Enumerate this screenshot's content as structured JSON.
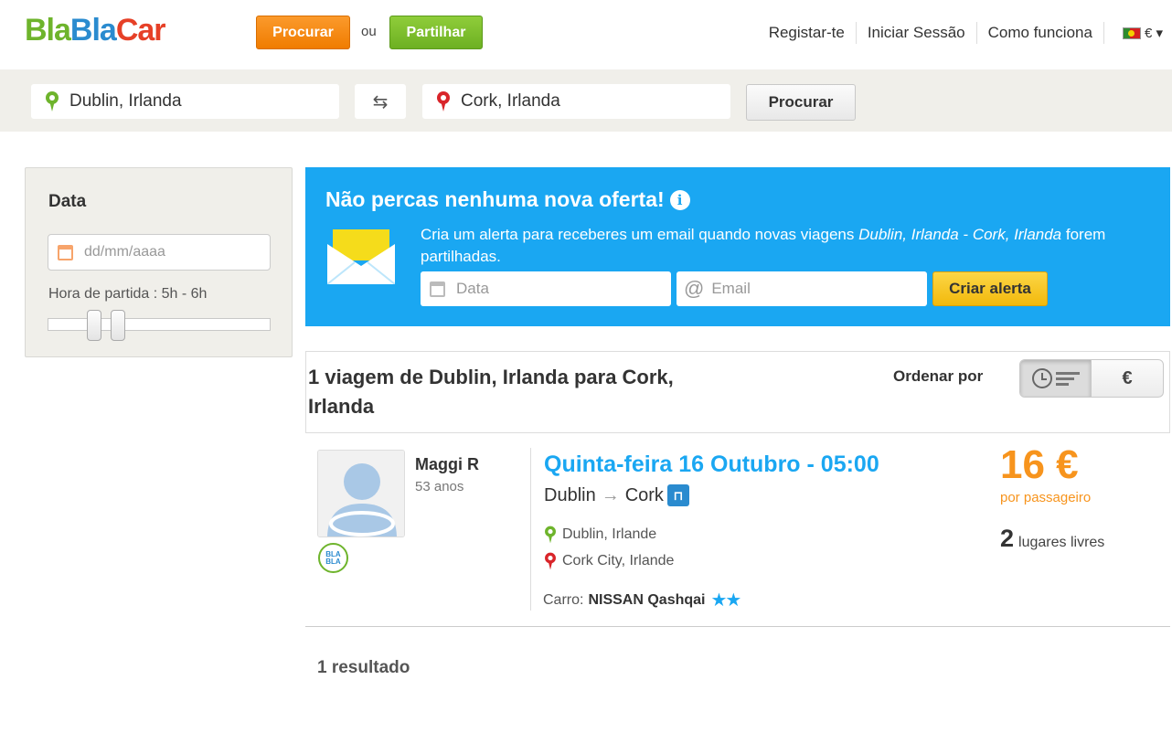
{
  "header": {
    "logo": {
      "part1": "Bla",
      "part2": "Bla",
      "part3": "Car"
    },
    "procurar_label": "Procurar",
    "ou_label": "ou",
    "partilhar_label": "Partilhar",
    "nav": {
      "register": "Registar-te",
      "login": "Iniciar Sessão",
      "how": "Como funciona",
      "currency": "€ ▾"
    }
  },
  "search": {
    "from": "Dublin, Irlanda",
    "to": "Cork, Irlanda",
    "swap_icon": "⇆",
    "button": "Procurar"
  },
  "sidebar": {
    "title": "Data",
    "date_placeholder": "dd/mm/aaaa",
    "hora_label": "Hora de partida :  5h - 6h",
    "slider_range": {
      "min_hour": 5,
      "max_hour": 6
    }
  },
  "alert": {
    "headline": "Não percas nenhuma nova oferta!",
    "info_icon": "i",
    "desc_prefix": "Cria um alerta para receberes um email quando novas viagens ",
    "desc_route": "Dublin, Irlanda - Cork, Irlanda",
    "desc_suffix": " forem partilhadas.",
    "data_placeholder": "Data",
    "email_placeholder": "Email",
    "at_symbol": "@",
    "button": "Criar alerta"
  },
  "results": {
    "title": "1 viagem de Dublin, Irlanda para Cork, Irlanda",
    "ordenar": "Ordenar por",
    "sort_price_icon": "€",
    "count": "1 resultado"
  },
  "trip": {
    "driver_name": "Maggi R",
    "driver_age": "53 anos",
    "badge_line1": "BLA",
    "badge_line2": "BLA",
    "date": "Quinta-feira 16 Outubro - 05:00",
    "route_from": "Dublin",
    "route_arrow": "→",
    "route_to": "Cork",
    "highway_icon": "⊓",
    "stop1": "Dublin, Irlande",
    "stop2": "Cork City, Irlande",
    "car_label": "Carro:",
    "car_model": "NISSAN Qashqai",
    "stars": "★★",
    "price": "16 €",
    "per": "por passageiro",
    "seats_count": "2",
    "seats_label": "lugares livres"
  },
  "colors": {
    "accent_blue": "#1aa7f2",
    "orange": "#f7941d",
    "green": "#6eb42c",
    "red": "#d9252a"
  }
}
